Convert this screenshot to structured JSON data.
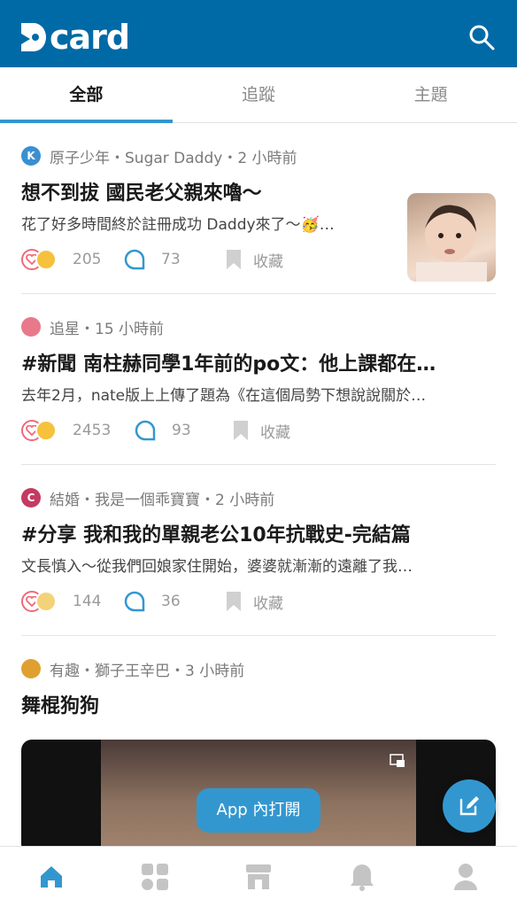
{
  "header": {
    "logo_text": "card",
    "brand_color": "#006aa6"
  },
  "tabs": [
    {
      "label": "全部",
      "active": true
    },
    {
      "label": "追蹤",
      "active": false
    },
    {
      "label": "主題",
      "active": false
    }
  ],
  "posts": [
    {
      "forum_icon_letter": "K",
      "forum_icon_color": "#3a8fd1",
      "meta": "原子少年・Sugar Daddy・2 小時前",
      "title": "想不到拔 國民老父親來嚕～",
      "excerpt": "花了好多時間終於註冊成功 Daddy來了～🥳…",
      "likes": "205",
      "comments": "73",
      "save_label": "收藏",
      "has_thumbnail": true
    },
    {
      "forum_icon_letter": "",
      "forum_icon_color": "#e8788a",
      "meta": "追星・15 小時前",
      "title": "#新聞 南柱赫同學1年前的po文：他上課都在…",
      "excerpt": "去年2月，nate版上上傳了題為《在這個局勢下想說說關於…",
      "likes": "2453",
      "comments": "93",
      "save_label": "收藏",
      "has_thumbnail": false
    },
    {
      "forum_icon_letter": "C",
      "forum_icon_color": "#c43a63",
      "meta": "結婚・我是一個乖寶寶・2 小時前",
      "title": "#分享 我和我的單親老公10年抗戰史-完結篇",
      "excerpt": "文長慎入～從我們回娘家住開始，婆婆就漸漸的遠離了我…",
      "likes": "144",
      "comments": "36",
      "save_label": "收藏",
      "has_thumbnail": false
    },
    {
      "forum_icon_letter": "",
      "forum_icon_color": "#e0a030",
      "meta": "有趣・獅子王辛巴・3 小時前",
      "title": "舞棍狗狗"
    }
  ],
  "video": {
    "app_open_label": "App 內打開"
  },
  "bottom_nav": [
    {
      "icon": "home-icon",
      "active": true
    },
    {
      "icon": "boards-icon",
      "active": false
    },
    {
      "icon": "shop-icon",
      "active": false
    },
    {
      "icon": "bell-icon",
      "active": false
    },
    {
      "icon": "profile-icon",
      "active": false
    }
  ],
  "colors": {
    "accent": "#3397cf",
    "inactive": "#c4c4c4"
  }
}
